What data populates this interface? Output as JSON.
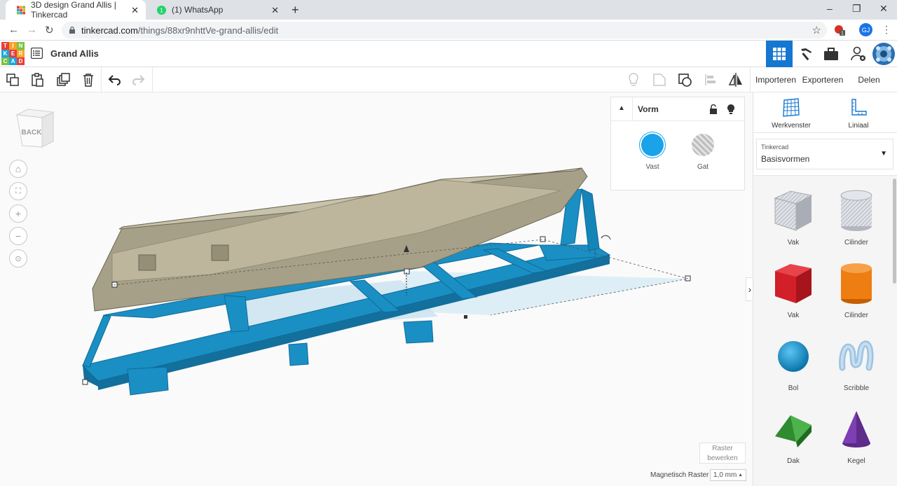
{
  "browser": {
    "tabs": [
      {
        "title": "3D design Grand Allis | Tinkercad",
        "active": true
      },
      {
        "title": "(1) WhatsApp",
        "active": false,
        "badge": "1"
      }
    ],
    "url_host": "tinkercad.com",
    "url_path": "/things/88xr9nhttVe-grand-allis/edit",
    "profile_initials": "GJ",
    "extension_badge": "1"
  },
  "app": {
    "logo_letters": [
      "T",
      "I",
      "N",
      "K",
      "E",
      "R",
      "C",
      "A",
      "D"
    ],
    "design_title": "Grand Allis"
  },
  "toolbar": {
    "import_label": "Importeren",
    "export_label": "Exporteren",
    "share_label": "Delen"
  },
  "viewcube": {
    "face_label": "BACK"
  },
  "shape_panel": {
    "title": "Vorm",
    "solid_label": "Vast",
    "hole_label": "Gat"
  },
  "workplane": {
    "edit_grid_label_1": "Raster",
    "edit_grid_label_2": "bewerken",
    "snap_label": "Magnetisch Raster",
    "snap_value": "1,0 mm"
  },
  "right_panel": {
    "workplane_tool": "Werkvenster",
    "ruler_tool": "Liniaal",
    "library_small": "Tinkercad",
    "library_main": "Basisvormen",
    "shapes": [
      {
        "label": "Vak",
        "icon": "box-striped-icon"
      },
      {
        "label": "Cilinder",
        "icon": "cylinder-striped-icon"
      },
      {
        "label": "Vak",
        "icon": "box-red-icon"
      },
      {
        "label": "Cilinder",
        "icon": "cylinder-orange-icon"
      },
      {
        "label": "Bol",
        "icon": "sphere-blue-icon"
      },
      {
        "label": "Scribble",
        "icon": "scribble-icon"
      },
      {
        "label": "Dak",
        "icon": "roof-green-icon"
      },
      {
        "label": "Kegel",
        "icon": "cone-purple-icon"
      }
    ]
  },
  "colors": {
    "accent": "#1477d1",
    "trailer": "#1a8fc4",
    "boat_hull": "#a6a089",
    "solid": "#1aa3e8",
    "logo": [
      "#e93e3a",
      "#f6a623",
      "#7ac143",
      "#19a7df",
      "#e93e3a",
      "#f6a623",
      "#7ac143",
      "#19a7df",
      "#e93e3a"
    ]
  }
}
